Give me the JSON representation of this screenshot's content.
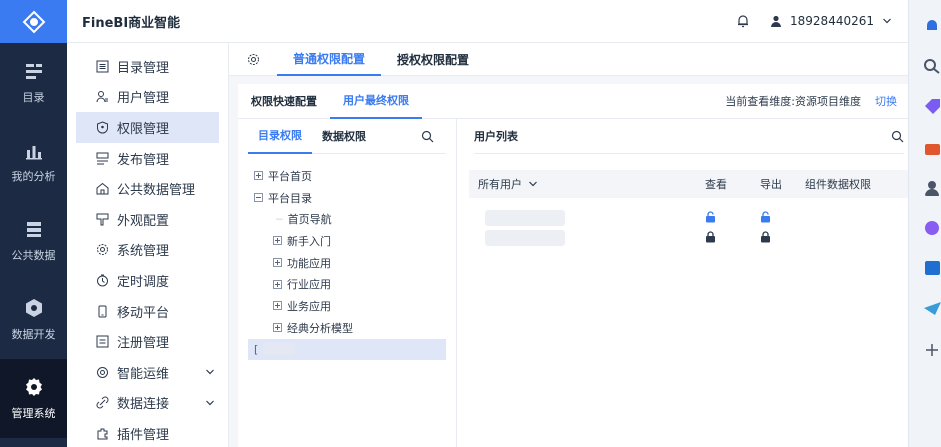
{
  "app": {
    "brand": "FineBI商业智能",
    "user": "18928440261",
    "colors": {
      "accent": "#3a7bf1",
      "rail": "#1c2a43",
      "selected": "#dfe6f8"
    }
  },
  "rail": [
    {
      "label": "目录",
      "icon": "catalog-icon"
    },
    {
      "label": "我的分析",
      "icon": "analysis-icon"
    },
    {
      "label": "公共数据",
      "icon": "public-data-icon"
    },
    {
      "label": "数据开发",
      "icon": "data-dev-icon"
    },
    {
      "label": "管理系统",
      "icon": "admin-icon",
      "active": true
    }
  ],
  "menu": [
    {
      "label": "目录管理",
      "icon": "list-icon"
    },
    {
      "label": "用户管理",
      "icon": "user-icon"
    },
    {
      "label": "权限管理",
      "icon": "shield-icon",
      "active": true
    },
    {
      "label": "发布管理",
      "icon": "publish-icon"
    },
    {
      "label": "公共数据管理",
      "icon": "home-icon"
    },
    {
      "label": "外观配置",
      "icon": "appearance-icon"
    },
    {
      "label": "系统管理",
      "icon": "gear-icon"
    },
    {
      "label": "定时调度",
      "icon": "clock-icon"
    },
    {
      "label": "移动平台",
      "icon": "mobile-icon"
    },
    {
      "label": "注册管理",
      "icon": "register-icon"
    },
    {
      "label": "智能运维",
      "icon": "ops-icon",
      "expandable": true
    },
    {
      "label": "数据连接",
      "icon": "link-icon",
      "expandable": true
    },
    {
      "label": "插件管理",
      "icon": "plugin-icon"
    }
  ],
  "main": {
    "tabs": [
      "普通权限配置",
      "授权权限配置"
    ],
    "subtabs": [
      "权限快速配置",
      "用户最终权限"
    ],
    "view_dimension": "当前查看维度:资源项目维度",
    "switch": "切换",
    "left_tabs": [
      "目录权限",
      "数据权限"
    ],
    "tree": [
      {
        "label": "平台首页",
        "depth": 0,
        "expander": "plus"
      },
      {
        "label": "平台目录",
        "depth": 0,
        "expander": "minus"
      },
      {
        "label": "首页导航",
        "depth": 1,
        "expander": "none"
      },
      {
        "label": "新手入门",
        "depth": 1,
        "expander": "plus"
      },
      {
        "label": "功能应用",
        "depth": 1,
        "expander": "plus"
      },
      {
        "label": "行业应用",
        "depth": 1,
        "expander": "plus"
      },
      {
        "label": "业务应用",
        "depth": 1,
        "expander": "plus"
      },
      {
        "label": "经典分析模型",
        "depth": 1,
        "expander": "plus"
      }
    ],
    "user_list_title": "用户列表",
    "columns": {
      "user": "所有用户",
      "view": "查看",
      "export": "导出",
      "component": "组件数据权限"
    }
  }
}
